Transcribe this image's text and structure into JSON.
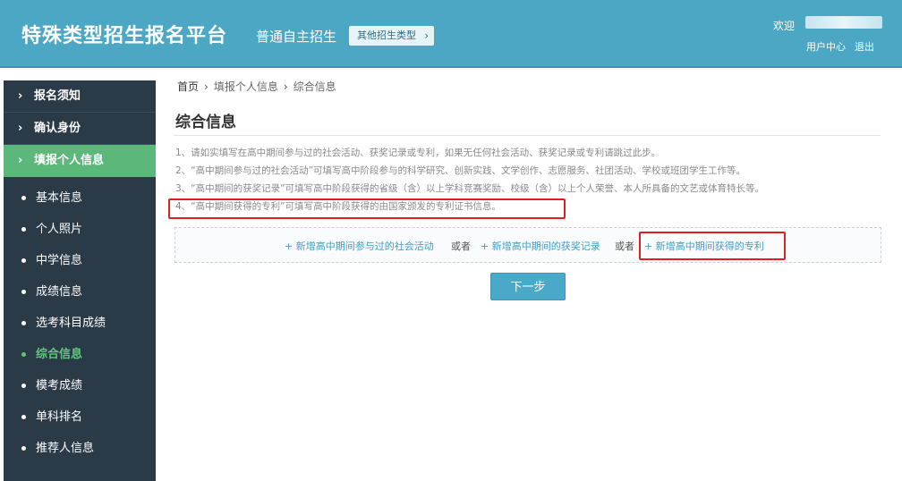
{
  "header": {
    "site_title": "特殊类型招生报名平台",
    "mode_title": "普通自主招生",
    "other_types_button": "其他招生类型",
    "welcome": "欢迎",
    "user_center": "用户中心",
    "logout": "退出"
  },
  "sidebar": {
    "main": [
      {
        "label": "报名须知"
      },
      {
        "label": "确认身份"
      },
      {
        "label": "填报个人信息"
      }
    ],
    "sub": [
      {
        "label": "基本信息"
      },
      {
        "label": "个人照片"
      },
      {
        "label": "中学信息"
      },
      {
        "label": "成绩信息"
      },
      {
        "label": "选考科目成绩"
      },
      {
        "label": "综合信息"
      },
      {
        "label": "模考成绩"
      },
      {
        "label": "单科排名"
      },
      {
        "label": "推荐人信息"
      }
    ]
  },
  "breadcrumb": {
    "home": "首页",
    "sep": "›",
    "level2": "填报个人信息",
    "current": "综合信息"
  },
  "page_title": "综合信息",
  "notes": [
    "1、请如实填写在高中期间参与过的社会活动、获奖记录或专利，如果无任何社会活动、获奖记录或专利请跳过此步。",
    "2、“高中期间参与过的社会活动”可填写高中阶段参与的科学研究、创新实践、文学创作、志愿服务、社团活动、学校或班团学生工作等。",
    "3、“高中期间的获奖记录”可填写高中阶段获得的省级（含）以上学科竞赛奖励、校级（含）以上个人荣誉、本人所具备的文艺或体育特长等。",
    "4、“高中期间获得的专利”可填写高中阶段获得的由国家颁发的专利证书信息。"
  ],
  "add": {
    "activity": "+ 新增高中期间参与过的社会活动",
    "or1": "或者",
    "award": "+ 新增高中期间的获奖记录",
    "or2": "或者",
    "patent": "+ 新增高中期间获得的专利"
  },
  "next_button": "下一步"
}
